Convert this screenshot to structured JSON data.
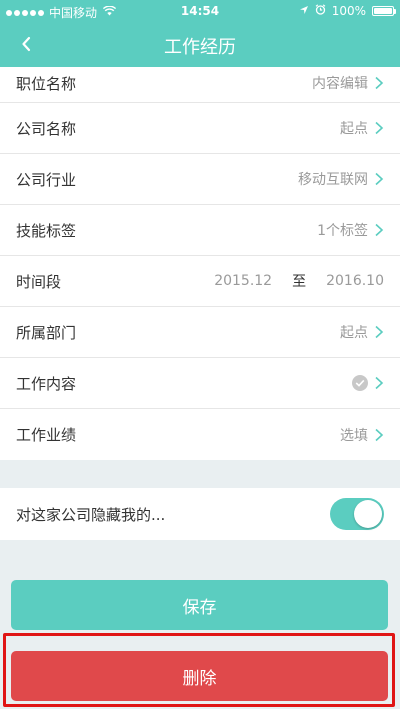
{
  "status_bar": {
    "carrier": "中国移动",
    "time": "14:54",
    "battery": "100%",
    "battery_level": 1.0
  },
  "nav": {
    "title": "工作经历",
    "back_icon": "chevron-left-icon"
  },
  "fields": [
    {
      "label": "职位名称",
      "value": "内容编辑"
    },
    {
      "label": "公司名称",
      "value": "起点"
    },
    {
      "label": "公司行业",
      "value": "移动互联网"
    },
    {
      "label": "技能标签",
      "value": "1个标签"
    },
    {
      "label": "时间段",
      "start": "2015.12",
      "separator": "至",
      "end": "2016.10"
    },
    {
      "label": "所属部门",
      "value": "起点"
    },
    {
      "label": "工作内容",
      "icon": "check-circle-icon"
    },
    {
      "label": "工作业绩",
      "value": "选填"
    }
  ],
  "privacy": {
    "label": "对这家公司隐藏我的...",
    "enabled": true
  },
  "actions": {
    "save": "保存",
    "delete": "删除"
  },
  "colors": {
    "accent": "#5bcdc0",
    "danger": "#e0494b",
    "highlight": "#e01515"
  }
}
